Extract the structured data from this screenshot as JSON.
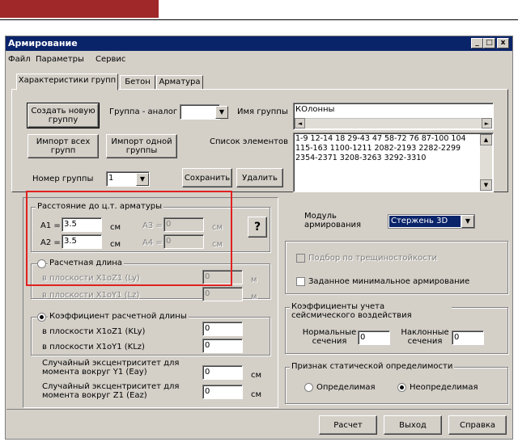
{
  "window": {
    "title": "Армирование",
    "buttons": {
      "minimize": "_",
      "maximize": "□",
      "close": "x"
    }
  },
  "menu": [
    "Файл",
    "Параметры",
    "Сервис"
  ],
  "tabs": [
    "Характеристики групп",
    "Бетон",
    "Арматура"
  ],
  "groups_panel": {
    "create_button": "Создать новую группу",
    "analog_label": "Группа - аналог",
    "analog_value": "",
    "group_name_label": "Имя группы",
    "group_name_value": "КОлонны",
    "import_all_button": "Импорт всех групп",
    "import_one_button": "Импорт одной группы",
    "element_list_label": "Список элементов",
    "element_list_value": "1-9 12-14 18 29-43 47 58-72 76 87-100 104 115-163 1100-1211 2082-2193 2282-2299 2354-2371 3208-3263 3292-3310",
    "group_number_label": "Номер группы",
    "group_number_value": "1",
    "save_button": "Сохранить",
    "delete_button": "Удалить"
  },
  "distance_group": {
    "title": "Расстояние до ц.т. арматуры",
    "a1_label": "A1 =",
    "a1_value": "3.5",
    "a2_label": "A2 =",
    "a2_value": "3.5",
    "a3_label": "A3 =",
    "a3_value": "0",
    "a4_label": "A4 =",
    "a4_value": "0",
    "unit": "см",
    "help_button": "?"
  },
  "design_length": {
    "radio_label": "Расчетная длина",
    "ly_label": "в плоскости X1oZ1  (Ly)",
    "ly_value": "0",
    "lz_label": "в плоскости X1oY1  (Lz)",
    "lz_value": "0",
    "unit": "м"
  },
  "length_coef": {
    "radio_label": "Коэффициент расчетной длины",
    "kly_label": "в плоскости X1oZ1  (KLy)",
    "kly_value": "0",
    "klz_label": "в плоскости X1oY1  (KLz)",
    "klz_value": "0"
  },
  "eccentricity": {
    "eay_label": "Случайный эксцентриситет для момента вокруг Y1  (Eay)",
    "eay_value": "0",
    "eaz_label": "Случайный эксцентриситет для момента вокруг Z1  (Eaz)",
    "eaz_value": "0",
    "unit": "см"
  },
  "module": {
    "label": "Модуль армирования",
    "value": "Стержень 3D"
  },
  "options": {
    "crack_check": "Подбор по трещиностойкости",
    "min_reinf": "Заданное минимальное армирование"
  },
  "seismic": {
    "title": "Коэффициенты учета сейсмического воздействия",
    "normal_label": "Нормальные сечения",
    "normal_value": "0",
    "inclined_label": "Наклонные сечения",
    "inclined_value": "0"
  },
  "static": {
    "title": "Признак статической определимости",
    "determinate": "Определимая",
    "indeterminate": "Неопределимая"
  },
  "footer": {
    "calc_button": "Расчет",
    "exit_button": "Выход",
    "help_button": "Справка"
  },
  "colors": {
    "window_bg": "#d4d0c8",
    "title_bg": "#0a246a",
    "highlight_box": "#e02020",
    "top_bar": "#a02828"
  }
}
